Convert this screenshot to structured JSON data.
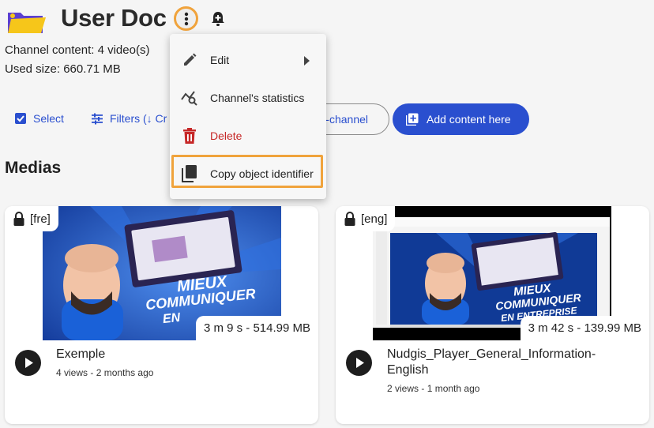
{
  "header": {
    "title": "User Doc"
  },
  "channel_meta": {
    "content_line": "Channel content:  4 video(s)",
    "size_line": "Used size: 660.71 MB"
  },
  "toolbar": {
    "select_label": "Select",
    "filters_label": "Filters (↓ Cr",
    "subchannel_label": "-channel",
    "add_label": "Add content here"
  },
  "section": {
    "title": "Medias"
  },
  "media": [
    {
      "lang": "[fre]",
      "duration": "3 m 9 s - 514.99 MB",
      "title": "Exemple",
      "views": "4 views",
      "age": "2 months ago",
      "thumb_text1": "MIEUX",
      "thumb_text2": "COMMUNIQUER",
      "thumb_text3": "EN"
    },
    {
      "lang": "[eng]",
      "duration": "3 m 42 s - 139.99 MB",
      "title": "Nudgis_Player_General_Information-English",
      "views": "2 views",
      "age": "1 month ago",
      "thumb_text1": "MIEUX",
      "thumb_text2": "COMMUNIQUER",
      "thumb_text3": "EN ENTREPRISE"
    }
  ],
  "context_menu": {
    "edit": "Edit",
    "stats": "Channel's statistics",
    "delete": "Delete",
    "copy": "Copy object identifier"
  },
  "colors": {
    "accent": "#2a4fcf",
    "highlight": "#f0a33c",
    "danger": "#c62828"
  }
}
